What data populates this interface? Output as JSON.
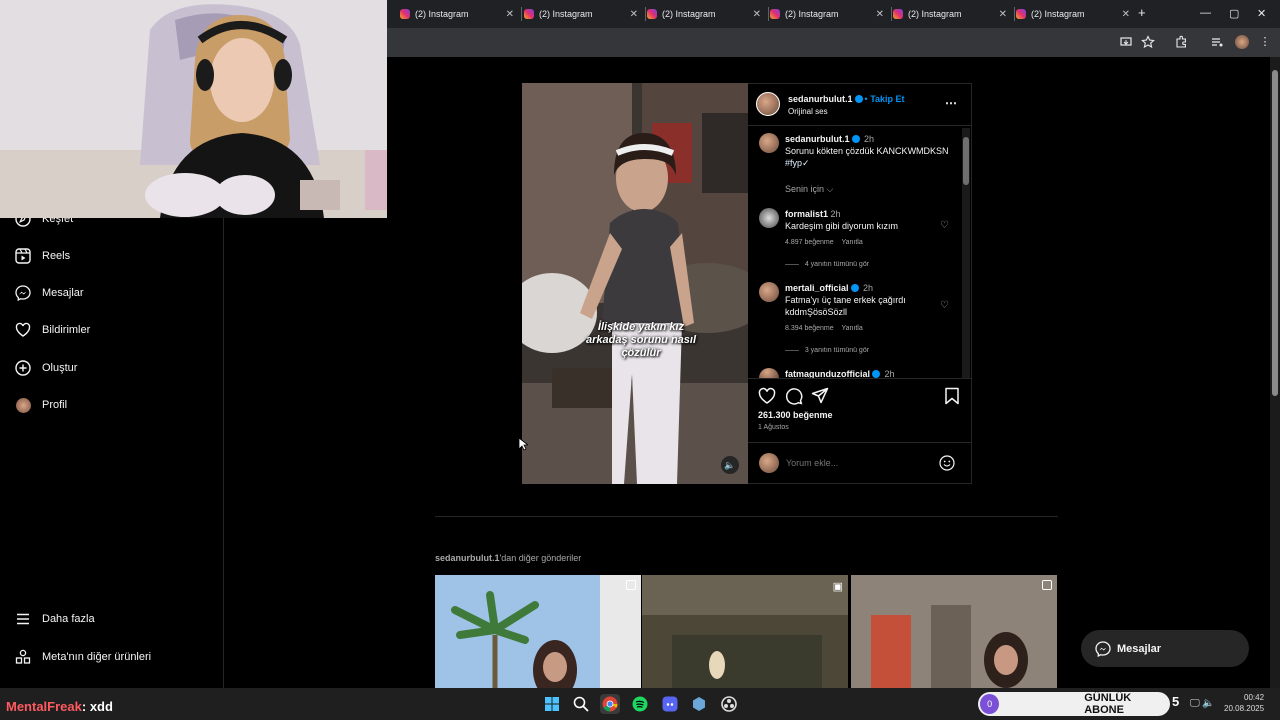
{
  "browser": {
    "tabs": [
      {
        "label": "(2) Instagram"
      },
      {
        "label": "(2) Instagram"
      },
      {
        "label": "(2) Instagram"
      },
      {
        "label": "(2) Instagram"
      },
      {
        "label": "(2) Instagram"
      },
      {
        "label": "(2) Instagram"
      }
    ],
    "new_tab": "+",
    "tab_close": "✕",
    "window_controls": {
      "minimize": "—",
      "maximize": "▢",
      "close": "✕"
    }
  },
  "sidebar": {
    "items": [
      {
        "label": "Keşfet",
        "icon": "compass-icon"
      },
      {
        "label": "Reels",
        "icon": "reels-icon"
      },
      {
        "label": "Mesajlar",
        "icon": "messenger-icon"
      },
      {
        "label": "Bildirimler",
        "icon": "heart-icon"
      },
      {
        "label": "Oluştur",
        "icon": "plus-square-icon"
      },
      {
        "label": "Profil",
        "icon": "avatar-icon"
      }
    ],
    "more": {
      "label": "Daha fazla",
      "icon": "menu-icon"
    },
    "meta": {
      "label": "Meta'nın diğer ürünleri",
      "icon": "meta-grid-icon"
    }
  },
  "post": {
    "author": "sedanurbulut.1",
    "follow": "Takip Et",
    "separator": "•",
    "audio": "Orijinal ses",
    "overlay_text_lines": [
      "İlişkide yakın kız",
      "arkadaş sorunu nasıl",
      "çözülür"
    ],
    "caption": {
      "author": "sedanurbulut.1",
      "time": "2h",
      "text": "Sorunu kökten çözdük KANCKWMDKSN",
      "hashtag": "#fyp✓"
    },
    "sort_label": "Senin için",
    "comments": [
      {
        "author": "formalist1",
        "verified": false,
        "time": "2h",
        "text": "Kardeşim gibi diyorum kızım",
        "likes": "4.897 beğenme",
        "reply": "Yanıtla",
        "view_replies": "4 yanıtın tümünü gör"
      },
      {
        "author": "mertali_official",
        "verified": true,
        "time": "2h",
        "text_lines": [
          "Fatma'yı üç tane erkek çağırdı",
          "kddmŞösöSözll"
        ],
        "likes": "8.394 beğenme",
        "reply": "Yanıtla",
        "view_replies": "3 yanıtın tümünü gör"
      },
      {
        "author": "fatmagunduzofficial",
        "verified": true,
        "time": "2h"
      }
    ],
    "likes": "261.300 beğenme",
    "date": "1 Ağustos",
    "comment_placeholder": "Yorum ekle...",
    "more_icon": "⋯"
  },
  "more_posts": {
    "author": "sedanurbulut.1",
    "suffix": "'dan diğer gönderiler"
  },
  "messages_button": {
    "label": "Mesajlar"
  },
  "stream": {
    "chat_user": "MentalFreak",
    "chat_message": ": xdd",
    "sub_count": "0",
    "sub_label": "GÜNLÜK ABONE",
    "sub_digit": "5"
  },
  "taskbar": {
    "time": "00:42",
    "date": "20.08.2025"
  }
}
